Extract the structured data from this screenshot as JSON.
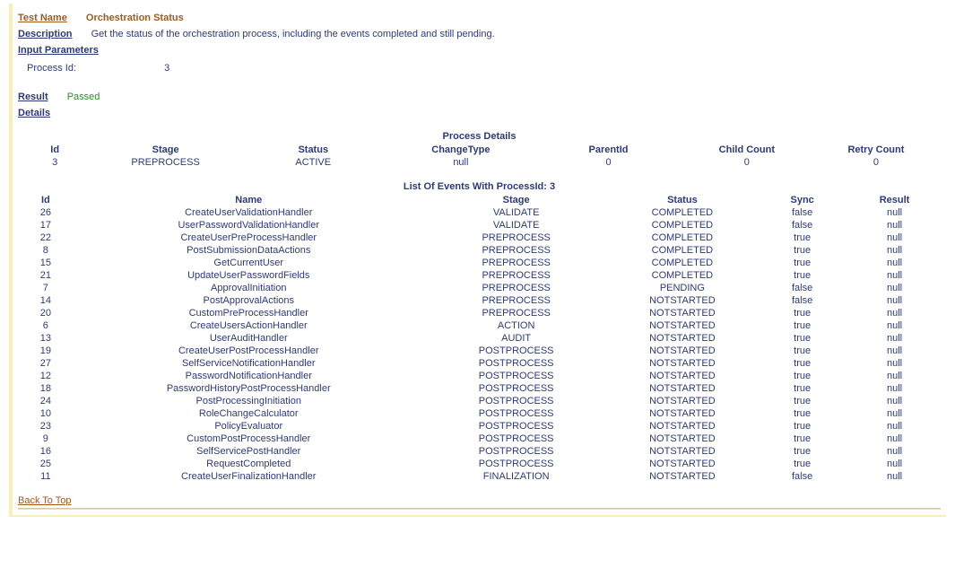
{
  "labels": {
    "test_name": "Test Name",
    "description": "Description",
    "input_parameters": "Input Parameters",
    "result": "Result",
    "details": "Details",
    "back_to_top": "Back To Top"
  },
  "test_name_value": "Orchestration Status",
  "description_value": "Get the status of the orchestration process, including the events completed and still pending.",
  "input_parameter": {
    "key": "Process Id:",
    "value": "3"
  },
  "result_value": "Passed",
  "process_details": {
    "title": "Process Details",
    "headers": {
      "id": "Id",
      "stage": "Stage",
      "status": "Status",
      "change_type": "ChangeType",
      "parent_id": "ParentId",
      "child_count": "Child Count",
      "retry_count": "Retry Count"
    },
    "row": {
      "id": "3",
      "stage": "PREPROCESS",
      "status": "ACTIVE",
      "change_type": "null",
      "parent_id": "0",
      "child_count": "0",
      "retry_count": "0"
    }
  },
  "events": {
    "title": "List Of Events With ProcessId: 3",
    "headers": {
      "id": "Id",
      "name": "Name",
      "stage": "Stage",
      "status": "Status",
      "sync": "Sync",
      "result": "Result"
    },
    "rows": [
      {
        "id": "26",
        "name": "CreateUserValidationHandler",
        "stage": "VALIDATE",
        "status": "COMPLETED",
        "sync": "false",
        "result": "null"
      },
      {
        "id": "17",
        "name": "UserPasswordValidationHandler",
        "stage": "VALIDATE",
        "status": "COMPLETED",
        "sync": "false",
        "result": "null"
      },
      {
        "id": "22",
        "name": "CreateUserPreProcessHandler",
        "stage": "PREPROCESS",
        "status": "COMPLETED",
        "sync": "true",
        "result": "null"
      },
      {
        "id": "8",
        "name": "PostSubmissionDataActions",
        "stage": "PREPROCESS",
        "status": "COMPLETED",
        "sync": "true",
        "result": "null"
      },
      {
        "id": "15",
        "name": "GetCurrentUser",
        "stage": "PREPROCESS",
        "status": "COMPLETED",
        "sync": "true",
        "result": "null"
      },
      {
        "id": "21",
        "name": "UpdateUserPasswordFields",
        "stage": "PREPROCESS",
        "status": "COMPLETED",
        "sync": "true",
        "result": "null"
      },
      {
        "id": "7",
        "name": "ApprovalInitiation",
        "stage": "PREPROCESS",
        "status": "PENDING",
        "sync": "false",
        "result": "null"
      },
      {
        "id": "14",
        "name": "PostApprovalActions",
        "stage": "PREPROCESS",
        "status": "NOTSTARTED",
        "sync": "false",
        "result": "null"
      },
      {
        "id": "20",
        "name": "CustomPreProcessHandler",
        "stage": "PREPROCESS",
        "status": "NOTSTARTED",
        "sync": "true",
        "result": "null"
      },
      {
        "id": "6",
        "name": "CreateUsersActionHandler",
        "stage": "ACTION",
        "status": "NOTSTARTED",
        "sync": "true",
        "result": "null"
      },
      {
        "id": "13",
        "name": "UserAuditHandler",
        "stage": "AUDIT",
        "status": "NOTSTARTED",
        "sync": "true",
        "result": "null"
      },
      {
        "id": "19",
        "name": "CreateUserPostProcessHandler",
        "stage": "POSTPROCESS",
        "status": "NOTSTARTED",
        "sync": "true",
        "result": "null"
      },
      {
        "id": "27",
        "name": "SelfServiceNotificationHandler",
        "stage": "POSTPROCESS",
        "status": "NOTSTARTED",
        "sync": "true",
        "result": "null"
      },
      {
        "id": "12",
        "name": "PasswordNotificationHandler",
        "stage": "POSTPROCESS",
        "status": "NOTSTARTED",
        "sync": "true",
        "result": "null"
      },
      {
        "id": "18",
        "name": "PasswordHistoryPostProcessHandler",
        "stage": "POSTPROCESS",
        "status": "NOTSTARTED",
        "sync": "true",
        "result": "null"
      },
      {
        "id": "24",
        "name": "PostProcessingInitiation",
        "stage": "POSTPROCESS",
        "status": "NOTSTARTED",
        "sync": "true",
        "result": "null"
      },
      {
        "id": "10",
        "name": "RoleChangeCalculator",
        "stage": "POSTPROCESS",
        "status": "NOTSTARTED",
        "sync": "true",
        "result": "null"
      },
      {
        "id": "23",
        "name": "PolicyEvaluator",
        "stage": "POSTPROCESS",
        "status": "NOTSTARTED",
        "sync": "true",
        "result": "null"
      },
      {
        "id": "9",
        "name": "CustomPostProcessHandler",
        "stage": "POSTPROCESS",
        "status": "NOTSTARTED",
        "sync": "true",
        "result": "null"
      },
      {
        "id": "16",
        "name": "SelfServicePostHandler",
        "stage": "POSTPROCESS",
        "status": "NOTSTARTED",
        "sync": "true",
        "result": "null"
      },
      {
        "id": "25",
        "name": "RequestCompleted",
        "stage": "POSTPROCESS",
        "status": "NOTSTARTED",
        "sync": "true",
        "result": "null"
      },
      {
        "id": "11",
        "name": "CreateUserFinalizationHandler",
        "stage": "FINALIZATION",
        "status": "NOTSTARTED",
        "sync": "false",
        "result": "null"
      }
    ]
  }
}
